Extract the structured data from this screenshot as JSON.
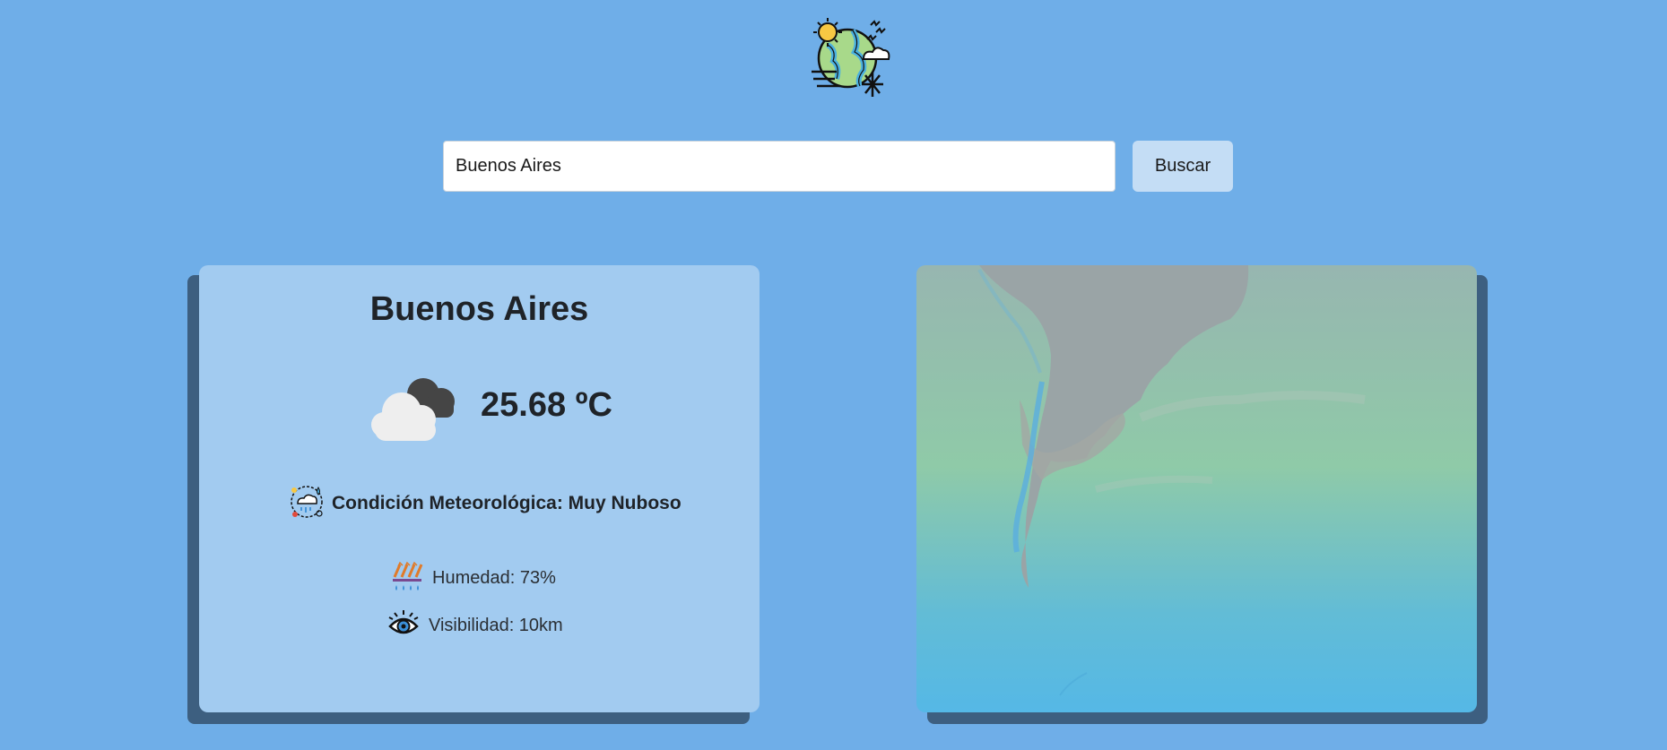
{
  "header": {
    "logo_icon": "weather-globe-icon"
  },
  "search": {
    "value": "Buenos Aires",
    "button_label": "Buscar"
  },
  "weather": {
    "city": "Buenos Aires",
    "temperature": "25.68 ºC",
    "condition_icon": "cloudy-icon",
    "condition": "Condición Meteorológica: Muy Nuboso",
    "humidity": "Humedad: 73%",
    "visibility": "Visibilidad: 10km"
  },
  "map": {
    "icon": "satellite-map"
  },
  "colors": {
    "background": "#6faee8",
    "card": "#a2cbf0",
    "button": "#c4ddf5",
    "shadow": "#3d5f80"
  }
}
